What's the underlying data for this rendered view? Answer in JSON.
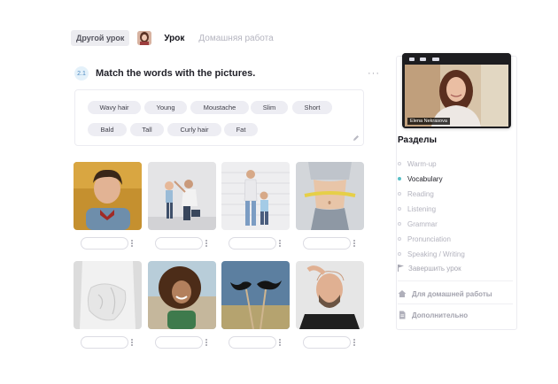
{
  "header": {
    "other_lesson_label": "Другой урок",
    "tabs": [
      {
        "label": "Урок",
        "active": true
      },
      {
        "label": "Домашняя работа",
        "active": false
      }
    ]
  },
  "exercise": {
    "number": "2.1",
    "title": "Match the words with the pictures.",
    "menu_icon": "more-icon",
    "words": [
      "Wavy hair",
      "Young",
      "Moustache",
      "Slim",
      "Short",
      "Bald",
      "Tall",
      "Curly hair",
      "Fat"
    ],
    "images": [
      "young-boy-photo",
      "tall-kid-photo",
      "short-child-photo",
      "slim-waist-photo",
      "fat-belly-photo",
      "curly-hair-woman-photo",
      "moustache-photo",
      "bald-man-photo"
    ]
  },
  "video": {
    "name": "Elena Nekrasova"
  },
  "sidebar": {
    "title": "Разделы",
    "items": [
      {
        "label": "Warm-up",
        "active": false
      },
      {
        "label": "Vocabulary",
        "active": true
      },
      {
        "label": "Reading",
        "active": false
      },
      {
        "label": "Listening",
        "active": false
      },
      {
        "label": "Grammar",
        "active": false
      },
      {
        "label": "Pronunciation",
        "active": false
      },
      {
        "label": "Speaking / Writing",
        "active": false
      }
    ],
    "finish_label": "Завершить урок",
    "homework_label": "Для домашней работы",
    "extra_label": "Дополнительно"
  },
  "colors": {
    "accent": "#58bfc6",
    "chip_bg": "#ededf3",
    "muted_text": "#b3b3be"
  }
}
